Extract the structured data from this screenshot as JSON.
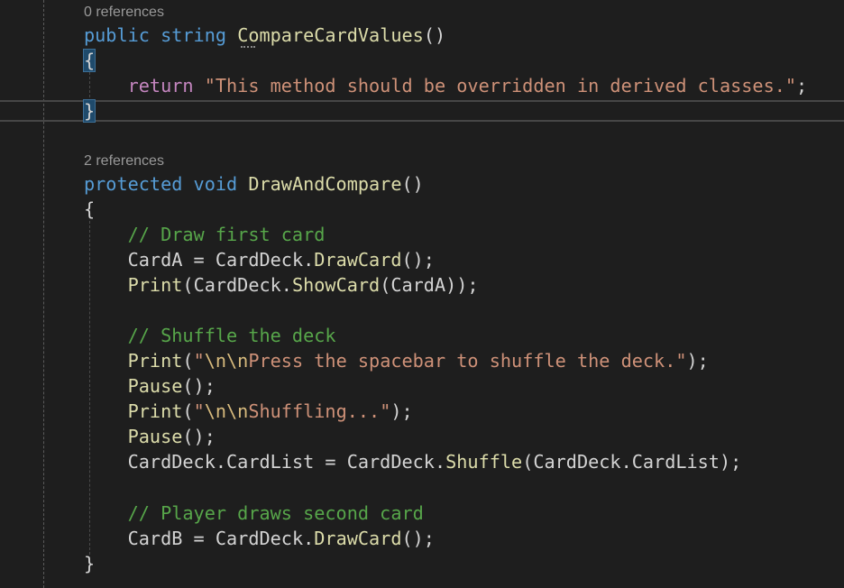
{
  "lens": {
    "first": "0 references",
    "second": "2 references"
  },
  "method1": {
    "modifier": "public",
    "return_type": "string",
    "name": "CompareCardValues",
    "params": "()",
    "open_brace": "{",
    "ret_keyword": "return",
    "ret_string": "\"This method should be overridden in derived classes.\"",
    "semicolon": ";",
    "close_brace": "}"
  },
  "method2": {
    "modifier": "protected",
    "return_type": "void",
    "name": "DrawAndCompare",
    "params": "()",
    "open_brace": "{",
    "close_brace": "}",
    "comment1": "// Draw first card",
    "l_carda": "CardA",
    "eq": " = ",
    "carddeck": "CardDeck",
    "dot": ".",
    "drawcard": "DrawCard",
    "call_end": "();",
    "print": "Print",
    "paren_open": "(",
    "showcard": "ShowCard",
    "showcard_args": "(CardA));",
    "comment2": "// Shuffle the deck",
    "str_quote_open": "\"",
    "esc_nn": "\\n\\n",
    "str_press": "Press the spacebar to shuffle the deck.\"",
    "close_paren_semi": ");",
    "pause": "Pause",
    "str_shuffling": "Shuffling...\"",
    "cardlist": "CardList",
    "shuffle": "Shuffle",
    "shuffle_args": "(CardDeck.CardList);",
    "comment3": "// Player draws second card",
    "l_cardb": "CardB"
  }
}
